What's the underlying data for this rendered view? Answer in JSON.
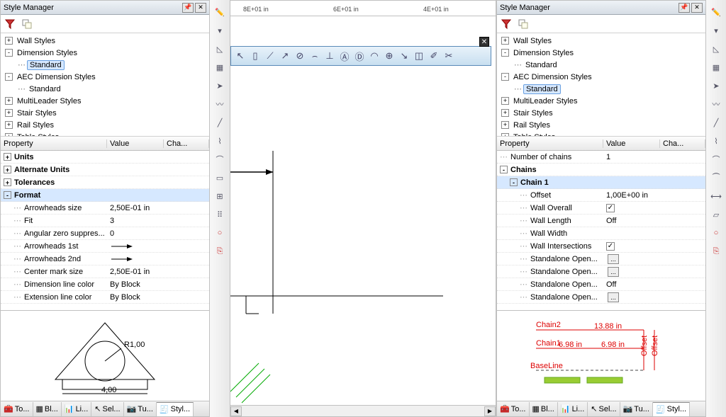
{
  "panel_title": "Style Manager",
  "left": {
    "tree": [
      {
        "toggle": "+",
        "label": "Wall Styles",
        "indent": 0,
        "bold": false
      },
      {
        "toggle": "-",
        "label": "Dimension Styles",
        "indent": 0,
        "bold": false
      },
      {
        "toggle": "",
        "label": "Standard",
        "indent": 1,
        "bold": false,
        "sel": true
      },
      {
        "toggle": "-",
        "label": "AEC Dimension Styles",
        "indent": 0,
        "bold": false
      },
      {
        "toggle": "",
        "label": "Standard",
        "indent": 1,
        "bold": false
      },
      {
        "toggle": "+",
        "label": "MultiLeader Styles",
        "indent": 0,
        "bold": false
      },
      {
        "toggle": "+",
        "label": "Stair Styles",
        "indent": 0,
        "bold": false
      },
      {
        "toggle": "+",
        "label": "Rail Styles",
        "indent": 0,
        "bold": false
      },
      {
        "toggle": "+",
        "label": "Table Styles",
        "indent": 0,
        "bold": false
      }
    ],
    "prop_header": {
      "c1": "Property",
      "c2": "Value",
      "c3": "Cha..."
    },
    "props": [
      {
        "toggle": "+",
        "name": "Units",
        "indent": 0,
        "group": true
      },
      {
        "toggle": "+",
        "name": "Alternate Units",
        "indent": 0,
        "group": true
      },
      {
        "toggle": "+",
        "name": "Tolerances",
        "indent": 0,
        "group": true
      },
      {
        "toggle": "-",
        "name": "Format",
        "indent": 0,
        "group": true,
        "sel": true
      },
      {
        "name": "Arrowheads size",
        "value": "2,50E-01 in",
        "indent": 1
      },
      {
        "name": "Fit",
        "value": "3",
        "indent": 1
      },
      {
        "name": "Angular zero suppres...",
        "value": "0",
        "indent": 1
      },
      {
        "name": "Arrowheads 1st",
        "value": "__arrow__",
        "indent": 1
      },
      {
        "name": "Arrowheads 2nd",
        "value": "__arrow__",
        "indent": 1
      },
      {
        "name": "Center mark size",
        "value": "2,50E-01 in",
        "indent": 1
      },
      {
        "name": "Dimension line color",
        "value": "By Block",
        "indent": 1
      },
      {
        "name": "Extension line color",
        "value": "By Block",
        "indent": 1
      }
    ]
  },
  "right": {
    "tree": [
      {
        "toggle": "+",
        "label": "Wall Styles",
        "indent": 0,
        "bold": false
      },
      {
        "toggle": "-",
        "label": "Dimension Styles",
        "indent": 0,
        "bold": false
      },
      {
        "toggle": "",
        "label": "Standard",
        "indent": 1,
        "bold": false
      },
      {
        "toggle": "-",
        "label": "AEC Dimension Styles",
        "indent": 0,
        "bold": false
      },
      {
        "toggle": "",
        "label": "Standard",
        "indent": 1,
        "bold": false,
        "sel": true
      },
      {
        "toggle": "+",
        "label": "MultiLeader Styles",
        "indent": 0,
        "bold": false
      },
      {
        "toggle": "+",
        "label": "Stair Styles",
        "indent": 0,
        "bold": false
      },
      {
        "toggle": "+",
        "label": "Rail Styles",
        "indent": 0,
        "bold": false
      },
      {
        "toggle": "+",
        "label": "Table Styles",
        "indent": 0,
        "bold": false
      }
    ],
    "prop_header": {
      "c1": "Property",
      "c2": "Value",
      "c3": "Cha..."
    },
    "props": [
      {
        "name": "Number of chains",
        "value": "1",
        "indent": 0
      },
      {
        "toggle": "-",
        "name": "Chains",
        "indent": 0,
        "group": true
      },
      {
        "toggle": "-",
        "name": "Chain 1",
        "indent": 1,
        "sel": true
      },
      {
        "name": "Offset",
        "value": "1,00E+00 in",
        "indent": 2
      },
      {
        "name": "Wall Overall",
        "value": "__check__",
        "indent": 2
      },
      {
        "name": "Wall Length",
        "value": "Off",
        "indent": 2
      },
      {
        "name": "Wall Width",
        "value": "",
        "indent": 2
      },
      {
        "name": "Wall Intersections",
        "value": "__check__",
        "indent": 2
      },
      {
        "name": "Standalone Open...",
        "value": "",
        "indent": 2,
        "btn": true
      },
      {
        "name": "Standalone Open...",
        "value": "",
        "indent": 2,
        "btn": true
      },
      {
        "name": "Standalone Open...",
        "value": "Off",
        "indent": 2
      },
      {
        "name": "Standalone Open...",
        "value": "",
        "indent": 2,
        "btn": true
      }
    ]
  },
  "ruler": {
    "marks": [
      "8E+01 in",
      "6E+01 in",
      "4E+01 in"
    ]
  },
  "bottom_tabs": [
    "To...",
    "Bl...",
    "Li...",
    "Sel...",
    "Tu...",
    "Styl..."
  ],
  "preview_right": {
    "chain2": "Chain2",
    "chain1": "Chain1",
    "baseline": "BaseLine",
    "d1": "6.98 in",
    "d2": "6.98 in",
    "d3": "13.88 in",
    "offset": "Offset"
  }
}
